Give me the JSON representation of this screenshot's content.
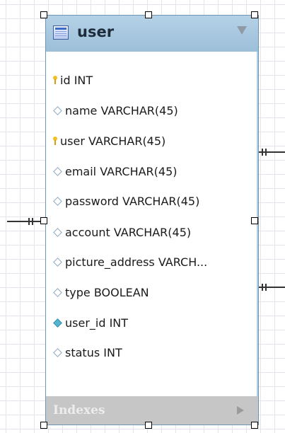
{
  "table": {
    "name": "user",
    "columns": [
      {
        "label": "id INT",
        "icon": "primary-key-icon"
      },
      {
        "label": "name VARCHAR(45)",
        "icon": "column-diamond-icon"
      },
      {
        "label": "user VARCHAR(45)",
        "icon": "primary-key-icon"
      },
      {
        "label": "email VARCHAR(45)",
        "icon": "column-diamond-icon"
      },
      {
        "label": "password VARCHAR(45)",
        "icon": "column-diamond-icon"
      },
      {
        "label": "account VARCHAR(45)",
        "icon": "column-diamond-icon"
      },
      {
        "label": "picture_address VARCH...",
        "icon": "column-diamond-icon"
      },
      {
        "label": "type BOOLEAN",
        "icon": "column-diamond-icon"
      },
      {
        "label": "user_id INT",
        "icon": "foreign-key-diamond-icon"
      },
      {
        "label": "status INT",
        "icon": "column-diamond-icon"
      }
    ],
    "indexes_label": "Indexes"
  },
  "colors": {
    "header": "#9cbfd9",
    "primary_key": "#f0c020",
    "foreign_key": "#56b4cf",
    "column_diamond": "#8ca8c0",
    "indexes_bar": "#c6c6c6",
    "canvas_grid": "#e4e4ec"
  }
}
